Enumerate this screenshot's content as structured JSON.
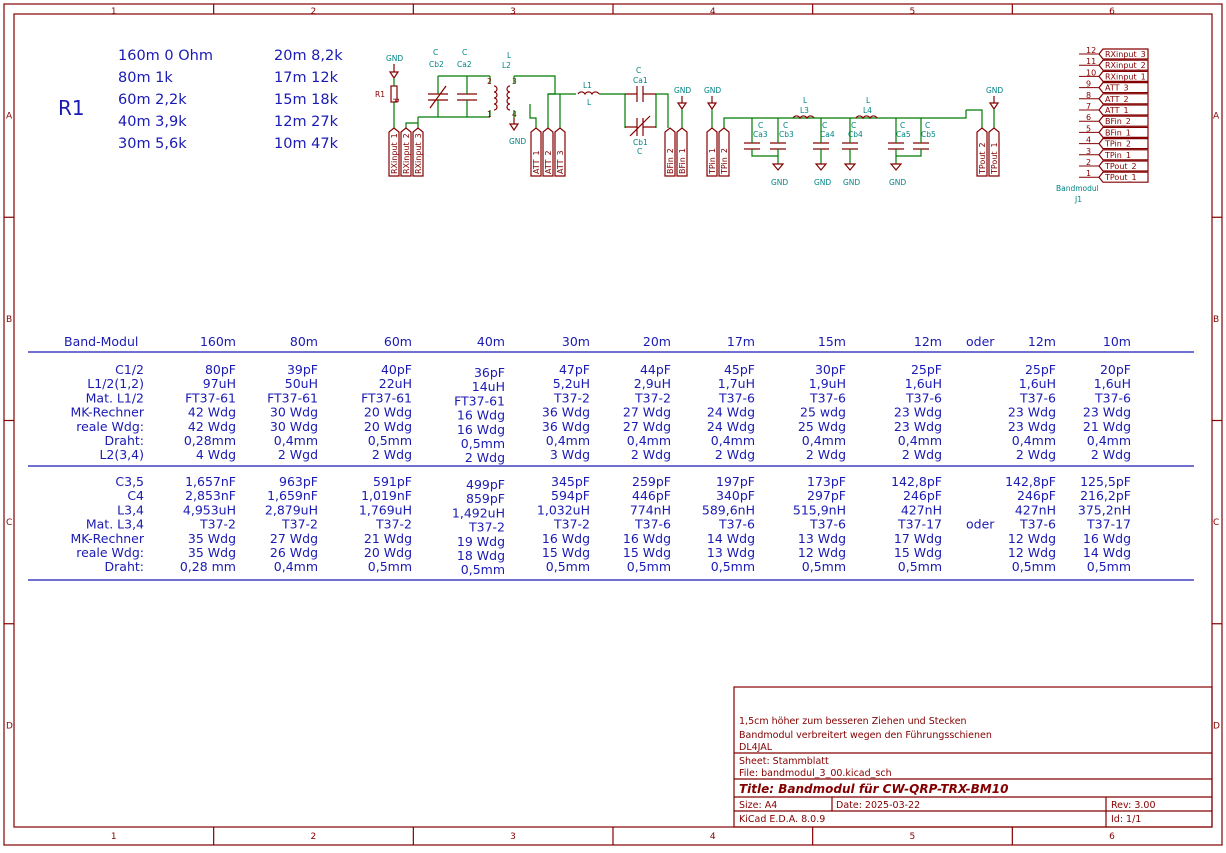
{
  "border": {
    "cols": [
      "1",
      "2",
      "3",
      "4",
      "5",
      "6"
    ],
    "rows": [
      "A",
      "B",
      "C",
      "D"
    ]
  },
  "r1_block": {
    "label": "R1",
    "col1": [
      "160m 0 Ohm",
      "80m 1k",
      "60m 2,2k",
      "40m 3,9k",
      "30m 5,6k"
    ],
    "col2": [
      "20m 8,2k",
      "17m 12k",
      "15m 18k",
      "12m 27k",
      "10m 47k"
    ]
  },
  "schematic": {
    "gnd": "GND",
    "r1": {
      "ref": "R1",
      "val": "R"
    },
    "cb2": {
      "ref": "Cb2",
      "val": "C"
    },
    "ca2": {
      "ref": "Ca2",
      "val": "C"
    },
    "l2": {
      "ref": "L2",
      "val": "L",
      "p1": "1",
      "p2": "2",
      "p3": "3",
      "p4": "4"
    },
    "l1": {
      "ref": "L1",
      "val": "L"
    },
    "ca1": {
      "ref": "Ca1",
      "val": "C"
    },
    "cb1": {
      "ref": "Cb1",
      "val": "C"
    },
    "ca3": {
      "ref": "Ca3",
      "val": "C"
    },
    "cb3": {
      "ref": "Cb3",
      "val": "C"
    },
    "l3": {
      "ref": "L3",
      "val": "L"
    },
    "ca4": {
      "ref": "Ca4",
      "val": "C"
    },
    "cb4": {
      "ref": "Cb4",
      "val": "C"
    },
    "l4": {
      "ref": "L4",
      "val": "L"
    },
    "ca5": {
      "ref": "Ca5",
      "val": "C"
    },
    "cb5": {
      "ref": "Cb5",
      "val": "C"
    },
    "labels": [
      "RXinput_1",
      "RXinput_2",
      "RXinput_3",
      "ATT_1",
      "ATT_2",
      "ATT_3",
      "BFin_2",
      "BFin_1",
      "TPin_1",
      "TPin_2",
      "TPout_2",
      "TPout_1"
    ],
    "j1": {
      "ref": "J1",
      "val": "Bandmodul",
      "pins": [
        {
          "n": "12",
          "l": "RXinput_3"
        },
        {
          "n": "11",
          "l": "RXinput_2"
        },
        {
          "n": "10",
          "l": "RXinput_1"
        },
        {
          "n": "9",
          "l": "ATT_3"
        },
        {
          "n": "8",
          "l": "ATT_2"
        },
        {
          "n": "7",
          "l": "ATT_1"
        },
        {
          "n": "6",
          "l": "BFin_2"
        },
        {
          "n": "5",
          "l": "BFin_1"
        },
        {
          "n": "4",
          "l": "TPin_2"
        },
        {
          "n": "3",
          "l": "TPin_1"
        },
        {
          "n": "2",
          "l": "TPout_2"
        },
        {
          "n": "1",
          "l": "TPout_1"
        }
      ]
    }
  },
  "table": {
    "header": [
      "Band-Modul",
      "160m",
      "80m",
      "60m",
      "40m",
      "30m",
      "20m",
      "17m",
      "15m",
      "12m",
      "oder",
      "12m",
      "10m"
    ],
    "section1": [
      [
        "C1/2",
        "80pF",
        "39pF",
        "40pF",
        "36pF",
        "47pF",
        "44pF",
        "45pF",
        "30pF",
        "25pF",
        "",
        "25pF",
        "20pF"
      ],
      [
        "L1/2(1,2)",
        "97uH",
        "50uH",
        "22uH",
        "14uH",
        "5,2uH",
        "2,9uH",
        "1,7uH",
        "1,9uH",
        "1,6uH",
        "",
        "1,6uH",
        "1,6uH"
      ],
      [
        "Mat. L1/2",
        "FT37-61",
        "FT37-61",
        "FT37-61",
        "FT37-61",
        "T37-2",
        "T37-2",
        "T37-6",
        "T37-6",
        "T37-6",
        "",
        "T37-6",
        "T37-6"
      ],
      [
        "MK-Rechner",
        "42 Wdg",
        "30 Wdg",
        "20 Wdg",
        "16 Wdg",
        "36 Wdg",
        "27 Wdg",
        "24 Wdg",
        "25 wdg",
        "23 Wdg",
        "",
        "23 Wdg",
        "23 Wdg"
      ],
      [
        "reale Wdg:",
        "42 Wdg",
        "30 Wdg",
        "20 Wdg",
        "16 Wdg",
        "36 Wdg",
        "27 Wdg",
        "24 Wdg",
        "25 Wdg",
        "23 Wdg",
        "",
        "23 Wdg",
        "21 Wdg"
      ],
      [
        "Draht:",
        "0,28mm",
        "0,4mm",
        "0,5mm",
        "0,5mm",
        "0,4mm",
        "0,4mm",
        "0,4mm",
        "0,4mm",
        "0,4mm",
        "",
        "0,4mm",
        "0,4mm"
      ],
      [
        "L2(3,4)",
        "4 Wdg",
        "2 Wgd",
        "2 Wdg",
        "2 Wdg",
        "3 Wdg",
        "2 Wdg",
        "2 Wdg",
        "2 Wdg",
        "2 Wdg",
        "",
        "2 Wdg",
        "2 Wdg"
      ]
    ],
    "section2": [
      [
        "C3,5",
        "1,657nF",
        "963pF",
        "591pF",
        "499pF",
        "345pF",
        "259pF",
        "197pF",
        "173pF",
        "142,8pF",
        "",
        "142,8pF",
        "125,5pF"
      ],
      [
        "C4",
        "2,853nF",
        "1,659nF",
        "1,019nF",
        "859pF",
        "594pF",
        "446pF",
        "340pF",
        "297pF",
        "246pF",
        "",
        "246pF",
        "216,2pF"
      ],
      [
        "L3,4",
        "4,953uH",
        "2,879uH",
        "1,769uH",
        "1,492uH",
        "1,032uH",
        "774nH",
        "589,6nH",
        "515,9nH",
        "427nH",
        "",
        "427nH",
        "375,2nH"
      ],
      [
        "Mat. L3,4",
        "T37-2",
        "T37-2",
        "T37-2",
        "T37-2",
        "T37-2",
        "T37-6",
        "T37-6",
        "T37-6",
        "T37-17",
        "oder",
        "T37-6",
        "T37-17"
      ],
      [
        "MK-Rechner",
        "35 Wdg",
        "27 Wdg",
        "21 Wdg",
        "19 Wdg",
        "16 Wdg",
        "16 Wdg",
        "14 Wdg",
        "13 Wdg",
        "17 Wdg",
        "",
        "12 Wdg",
        "16 Wdg"
      ],
      [
        "reale Wdg:",
        "35 Wdg",
        "26 Wdg",
        "20 Wdg",
        "18 Wdg",
        "15 Wdg",
        "15 Wdg",
        "13 Wdg",
        "12 Wdg",
        "15 Wdg",
        "",
        "12 Wdg",
        "14 Wdg"
      ],
      [
        "Draht:",
        "0,28 mm",
        "0,4mm",
        "0,5mm",
        "0,5mm",
        "0,5mm",
        "0,5mm",
        "0,5mm",
        "0,5mm",
        "0,5mm",
        "",
        "0,5mm",
        "0,5mm"
      ]
    ]
  },
  "title_block": {
    "comment1": "1,5cm höher zum besseren Ziehen und Stecken",
    "comment2": "Bandmodul verbreitert wegen den Führungsschienen",
    "comment3": "DL4JAL",
    "sheet": "Sheet: Stammblatt",
    "file": "File: bandmodul_3_00.kicad_sch",
    "title": "Title: Bandmodul für CW-QRP-TRX-BM10",
    "size": "Size: A4",
    "date": "Date: 2025-03-22",
    "rev": "Rev: 3.00",
    "tool": "KiCad E.D.A. 8.0.9",
    "id": "Id: 1/1"
  }
}
